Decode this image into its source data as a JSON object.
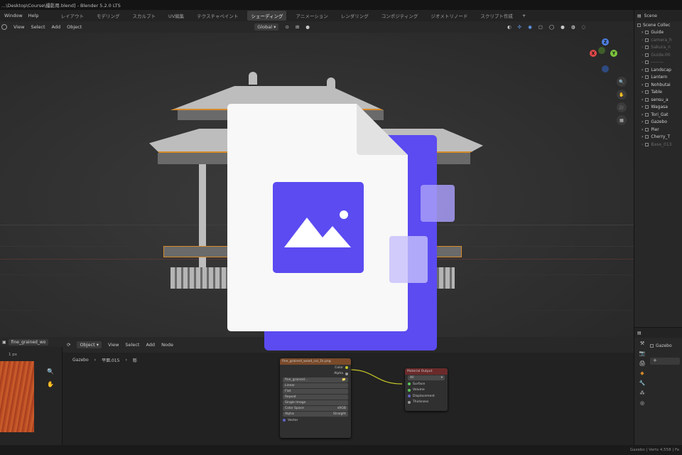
{
  "app": {
    "title": "...\\Desktop\\Course\\撮影用.blend] - Blender 5.2.0 LTS"
  },
  "menubar": {
    "menus": [
      "Window",
      "Help"
    ],
    "workspaces": [
      {
        "label": "レイアウト",
        "active": false
      },
      {
        "label": "モデリング",
        "active": false
      },
      {
        "label": "スカルプト",
        "active": false
      },
      {
        "label": "UV編集",
        "active": false
      },
      {
        "label": "テクスチャペイント",
        "active": false
      },
      {
        "label": "シェーディング",
        "active": true
      },
      {
        "label": "アニメーション",
        "active": false
      },
      {
        "label": "レンダリング",
        "active": false
      },
      {
        "label": "コンポジティング",
        "active": false
      },
      {
        "label": "ジオメトリノード",
        "active": false
      },
      {
        "label": "スクリプト作成",
        "active": false
      }
    ],
    "add_tab": "+",
    "scene_label": "Scene"
  },
  "viewport": {
    "menus": [
      "View",
      "Select",
      "Add",
      "Object"
    ],
    "orientation": "Global",
    "gizmo_axes": [
      "X",
      "Y",
      "Z"
    ]
  },
  "outliner": {
    "root": "Scene Collec",
    "items": [
      {
        "label": "Guide",
        "dim": false
      },
      {
        "label": "camera_h",
        "dim": true
      },
      {
        "label": "Sakura_n",
        "dim": true
      },
      {
        "label": "Guide.00",
        "dim": true
      },
      {
        "label": "--------",
        "dim": true
      },
      {
        "label": "Landscap",
        "dim": false
      },
      {
        "label": "Lantern",
        "dim": false
      },
      {
        "label": "Nohbutai",
        "dim": false
      },
      {
        "label": "Table",
        "dim": false
      },
      {
        "label": "sensu_a",
        "dim": false
      },
      {
        "label": "Wagasa",
        "dim": false
      },
      {
        "label": "Tori_Gat",
        "dim": false
      },
      {
        "label": "Gazebo",
        "dim": false
      },
      {
        "label": "Pier",
        "dim": false
      },
      {
        "label": "Cherry_T",
        "dim": false
      },
      {
        "label": "Base_013",
        "dim": true
      }
    ]
  },
  "properties": {
    "object_name": "Gazebo",
    "add_label": "+"
  },
  "image_editor": {
    "image_name": "fine_grained_wo",
    "pixel_label": "1 px"
  },
  "node_editor": {
    "mode": "Object",
    "menus": [
      "View",
      "Select",
      "Add",
      "Node"
    ],
    "breadcrumb": [
      "Gazebo",
      "平面.015",
      "彫"
    ],
    "image_node": {
      "title": "fine_grained_wood_col_1k.png",
      "outputs": [
        "Color",
        "Alpha"
      ],
      "image_field": "fine_grained...",
      "fields": [
        {
          "label": "Linear",
          "value": ""
        },
        {
          "label": "Flat",
          "value": ""
        },
        {
          "label": "Repeat",
          "value": ""
        },
        {
          "label": "Single Image",
          "value": ""
        },
        {
          "label": "Color Space",
          "value": "sRGB"
        },
        {
          "label": "Alpha",
          "value": "Straight"
        }
      ],
      "input": "Vector"
    },
    "output_node": {
      "title": "Material Output",
      "target": "All",
      "inputs": [
        "Surface",
        "Volume",
        "Displacement",
        "Thickness"
      ]
    }
  },
  "status": {
    "text": "Gazebo | Verts 4,558 | Fa"
  },
  "colors": {
    "accent": "#5b4bf1",
    "selection": "#d78a2a",
    "active_tab": "#3d3d3d"
  }
}
